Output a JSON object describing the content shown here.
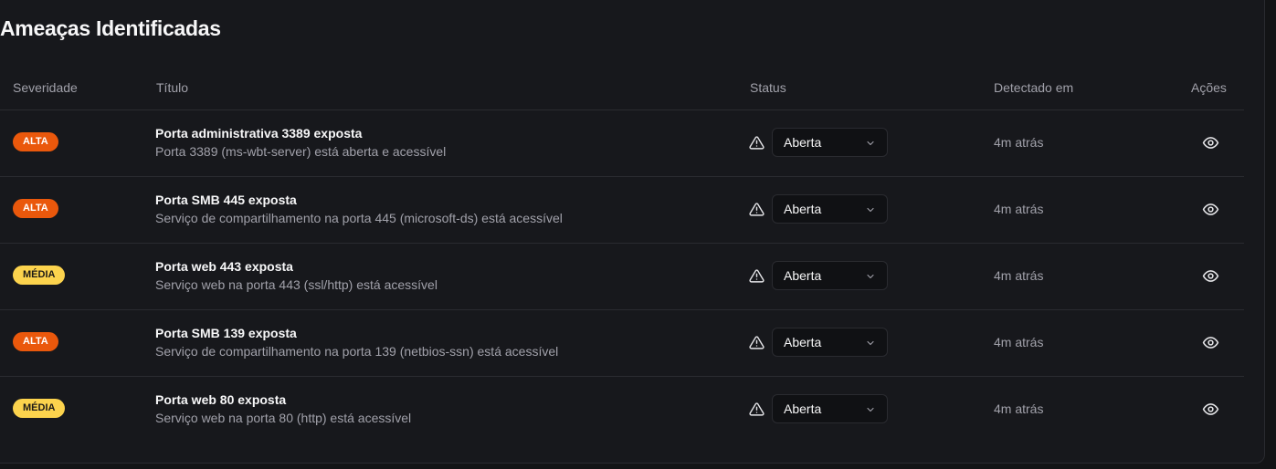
{
  "page": {
    "title": "Ameaças Identificadas"
  },
  "table": {
    "headers": {
      "severity": "Severidade",
      "title": "Título",
      "status": "Status",
      "detected": "Detectado em",
      "actions": "Ações"
    },
    "rows": [
      {
        "severity": "ALTA",
        "title": "Porta administrativa 3389 exposta",
        "description": "Porta 3389 (ms-wbt-server) está aberta e acessível",
        "status": "Aberta",
        "detected": "4m atrás"
      },
      {
        "severity": "ALTA",
        "title": "Porta SMB 445 exposta",
        "description": "Serviço de compartilhamento na porta 445 (microsoft-ds) está acessível",
        "status": "Aberta",
        "detected": "4m atrás"
      },
      {
        "severity": "MÉDIA",
        "title": "Porta web 443 exposta",
        "description": "Serviço web na porta 443 (ssl/http) está acessível",
        "status": "Aberta",
        "detected": "4m atrás"
      },
      {
        "severity": "ALTA",
        "title": "Porta SMB 139 exposta",
        "description": "Serviço de compartilhamento na porta 139 (netbios-ssn) está acessível",
        "status": "Aberta",
        "detected": "4m atrás"
      },
      {
        "severity": "MÉDIA",
        "title": "Porta web 80 exposta",
        "description": "Serviço web na porta 80 (http) está acessível",
        "status": "Aberta",
        "detected": "4m atrás"
      }
    ]
  },
  "colors": {
    "background": "#17181c",
    "alta": "#ea580c",
    "media": "#fcd34d",
    "muted_text": "#a1a1aa"
  },
  "icons": {
    "status": "warning-triangle-icon",
    "select": "chevron-down-icon",
    "action": "eye-icon"
  }
}
